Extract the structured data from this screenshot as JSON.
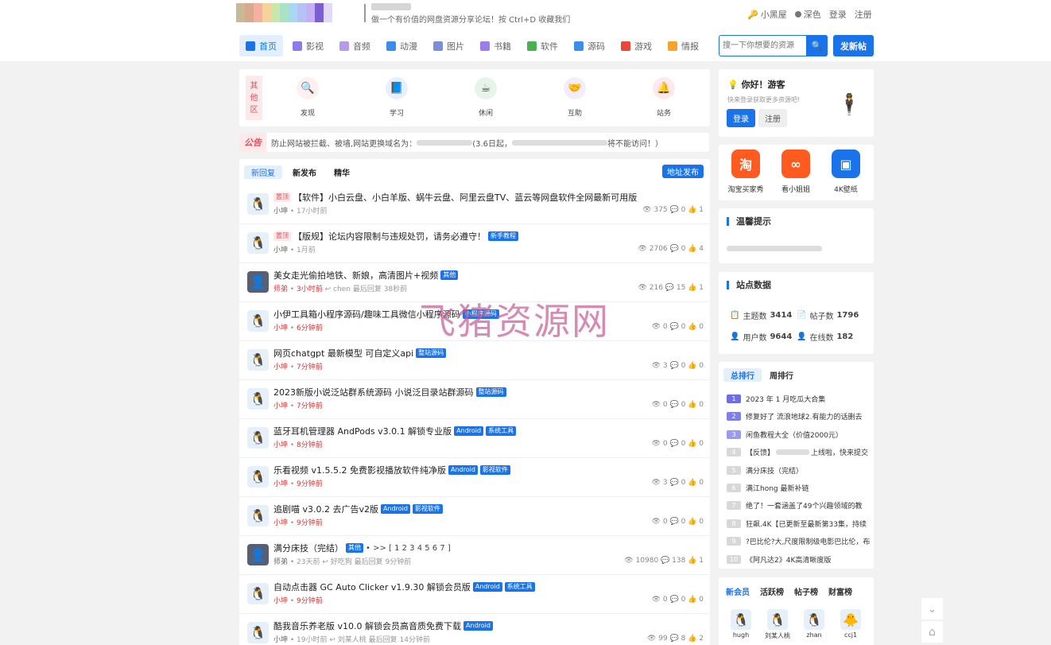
{
  "header": {
    "slogan": "做一个有价值的网盘资源分享论坛！按 Ctrl+D 收藏我们",
    "links": [
      "小黑屋",
      "深色",
      "登录",
      "注册"
    ]
  },
  "nav": [
    {
      "label": "首页",
      "icon": "home-icon",
      "color": "#1a73e8"
    },
    {
      "label": "影视",
      "icon": "video-icon",
      "color": "#8a7de8"
    },
    {
      "label": "音频",
      "icon": "audio-icon",
      "color": "#b59be8"
    },
    {
      "label": "动漫",
      "icon": "anime-icon",
      "color": "#3a8de8"
    },
    {
      "label": "图片",
      "icon": "image-icon",
      "color": "#7a8fd8"
    },
    {
      "label": "书籍",
      "icon": "book-icon",
      "color": "#9a7de8"
    },
    {
      "label": "软件",
      "icon": "software-icon",
      "color": "#4caf50"
    },
    {
      "label": "源码",
      "icon": "code-icon",
      "color": "#3a8de8"
    },
    {
      "label": "游戏",
      "icon": "game-icon",
      "color": "#e8473a"
    },
    {
      "label": "情报",
      "icon": "news-icon",
      "color": "#f4a52a"
    }
  ],
  "search": {
    "placeholder": "搜一下你想要的资源"
  },
  "post_button": "发新帖",
  "categories": {
    "label": "其他区",
    "items": [
      {
        "label": "发现",
        "icon": "🔍"
      },
      {
        "label": "学习",
        "icon": "📘"
      },
      {
        "label": "休闲",
        "icon": "☕"
      },
      {
        "label": "互助",
        "icon": "🤝"
      },
      {
        "label": "站务",
        "icon": "🔔"
      }
    ]
  },
  "notice": {
    "tag": "公告",
    "text_start": "防止网站被拦截、被墙,网站更换域名为：",
    "text_mid": "(3.6日起，",
    "text_end": "将不能访问！）"
  },
  "list_tabs": [
    "新回复",
    "新发布",
    "精华"
  ],
  "address_button": "地址发布",
  "threads": [
    {
      "top": "置顶",
      "title": "【软件】小白云盘、小白羊版、蜗牛云盘、阿里云盘TV、蓝云等网盘软件全网最新可用版",
      "tags": [],
      "author": "小坤",
      "time": "17小时前",
      "replier": "",
      "reply_time": "",
      "views": "375",
      "replies": "0",
      "likes": "1",
      "avatar": "🐧",
      "dark": false,
      "gray": true
    },
    {
      "top": "置顶",
      "title": "【版规】论坛内容限制与违规处罚，请务必遵守！",
      "tags": [
        "新手教程"
      ],
      "author": "小坤",
      "time": "1月前",
      "replier": "",
      "reply_time": "",
      "views": "2706",
      "replies": "0",
      "likes": "4",
      "avatar": "🐧",
      "dark": false,
      "gray": true
    },
    {
      "top": "",
      "title": "美女走光偷拍地铁、新娘，高清图片+视频",
      "tags": [
        "其他"
      ],
      "author": "师弟",
      "time": "3小时前",
      "replier": "chen",
      "reply_time": "最后回复 38秒前",
      "views": "216",
      "replies": "15",
      "likes": "1",
      "avatar": "👤",
      "dark": true,
      "gray": false
    },
    {
      "top": "",
      "title": "小伊工具箱小程序源码/趣味工具微信小程序源码",
      "tags": [
        "小程序源码"
      ],
      "author": "小坤",
      "time": "6分钟前",
      "replier": "",
      "reply_time": "",
      "views": "0",
      "replies": "0",
      "likes": "0",
      "avatar": "🐧",
      "dark": false,
      "gray": false
    },
    {
      "top": "",
      "title": "网页chatgpt 最新模型 可自定义api",
      "tags": [
        "整站源码"
      ],
      "author": "小坤",
      "time": "7分钟前",
      "replier": "",
      "reply_time": "",
      "views": "3",
      "replies": "0",
      "likes": "0",
      "avatar": "🐧",
      "dark": false,
      "gray": false
    },
    {
      "top": "",
      "title": "2023新版小说泛站群系统源码 小说泛目录站群源码",
      "tags": [
        "整站源码"
      ],
      "author": "小坤",
      "time": "7分钟前",
      "replier": "",
      "reply_time": "",
      "views": "0",
      "replies": "0",
      "likes": "0",
      "avatar": "🐧",
      "dark": false,
      "gray": false
    },
    {
      "top": "",
      "title": "蓝牙耳机管理器 AndPods v3.0.1 解锁专业版",
      "tags": [
        "Android",
        "系统工具"
      ],
      "author": "小坤",
      "time": "8分钟前",
      "replier": "",
      "reply_time": "",
      "views": "0",
      "replies": "0",
      "likes": "0",
      "avatar": "🐧",
      "dark": false,
      "gray": false
    },
    {
      "top": "",
      "title": "乐看视频 v1.5.5.2 免费影视播放软件纯净版",
      "tags": [
        "Android",
        "影视软件"
      ],
      "author": "小坤",
      "time": "9分钟前",
      "replier": "",
      "reply_time": "",
      "views": "3",
      "replies": "0",
      "likes": "0",
      "avatar": "🐧",
      "dark": false,
      "gray": false
    },
    {
      "top": "",
      "title": "追剧喵 v3.0.2 去广告v2版",
      "tags": [
        "Android",
        "影视软件"
      ],
      "author": "小坤",
      "time": "9分钟前",
      "replier": "",
      "reply_time": "",
      "views": "0",
      "replies": "0",
      "likes": "0",
      "avatar": "🐧",
      "dark": false,
      "gray": false
    },
    {
      "top": "",
      "title": "满分床技（完结）",
      "tags": [
        "其他"
      ],
      "pages": "• >> [ 1 2 3 4 5 6 7 ]",
      "author": "师弟",
      "time": "23天前",
      "replier": "好吃狗",
      "reply_time": "最后回复 9分钟前",
      "views": "10980",
      "replies": "138",
      "likes": "1",
      "avatar": "👤",
      "dark": true,
      "gray": true
    },
    {
      "top": "",
      "title": "自动点击器 GC Auto Clicker v1.9.30 解锁会员版",
      "tags": [
        "Android",
        "系统工具"
      ],
      "author": "小坤",
      "time": "9分钟前",
      "replier": "",
      "reply_time": "",
      "views": "0",
      "replies": "0",
      "likes": "0",
      "avatar": "🐧",
      "dark": false,
      "gray": false
    },
    {
      "top": "",
      "title": "酷我音乐养老版 v10.0 解锁会员高音质免费下载",
      "tags": [
        "Android"
      ],
      "author": "小坤",
      "time": "19小时前",
      "replier": "刘某人桃",
      "reply_time": "最后回复 14分钟前",
      "views": "99",
      "replies": "8",
      "likes": "2",
      "avatar": "🐧",
      "dark": false,
      "gray": true
    }
  ],
  "watermark": "飞猪资源网",
  "welcome": {
    "title": "你好！游客",
    "sub": "快来登录获取更多资源吧!",
    "login": "登录",
    "register": "注册"
  },
  "apps": [
    {
      "label": "淘宝买家秀",
      "icon": "淘",
      "color": "#ff5a1f"
    },
    {
      "label": "看小姐姐",
      "icon": "∞",
      "color": "#ff5a1f"
    },
    {
      "label": "4K壁纸",
      "icon": "▣",
      "color": "#1a73e8"
    }
  ],
  "tips_title": "温馨提示",
  "stats": {
    "title": "站点数据",
    "topics_label": "主题数",
    "topics": "3414",
    "posts_label": "帖子数",
    "posts": "1796",
    "users_label": "用户数",
    "users": "9644",
    "online_label": "在线数",
    "online": "182"
  },
  "rank_tabs": [
    "总排行",
    "周排行"
  ],
  "rank": [
    {
      "n": "1",
      "t": "2023 年 1 月吃瓜大合集"
    },
    {
      "n": "2",
      "t": "修复好了 流浪地球2.有能力的话删去"
    },
    {
      "n": "3",
      "t": "闲鱼教程大全（价值2000元）"
    },
    {
      "n": "4",
      "t": "【反馈】",
      "t2": "上线啦，快来提交"
    },
    {
      "n": "5",
      "t": "满分床技（完结）"
    },
    {
      "n": "6",
      "t": "满江hong 最新补链"
    },
    {
      "n": "7",
      "t": "绝了！一套涵盖了49个兴趣领域的教"
    },
    {
      "n": "8",
      "t": "狂飙.4K【已更新至最新第33集，持续"
    },
    {
      "n": "9",
      "t": "?巴比伦?大,尺度限制级电影巴比伦，布"
    },
    {
      "n": "10",
      "t": "《阿凡达2》4K高清晰度版"
    }
  ],
  "member_tabs": [
    "新会员",
    "活跃榜",
    "帖子榜",
    "财富榜"
  ],
  "members": [
    {
      "name": "hugh",
      "icon": "🐧"
    },
    {
      "name": "刘某人桃",
      "icon": "🐧"
    },
    {
      "name": "zhan",
      "icon": "🐧"
    },
    {
      "name": "ccj1",
      "icon": "🐥"
    }
  ]
}
